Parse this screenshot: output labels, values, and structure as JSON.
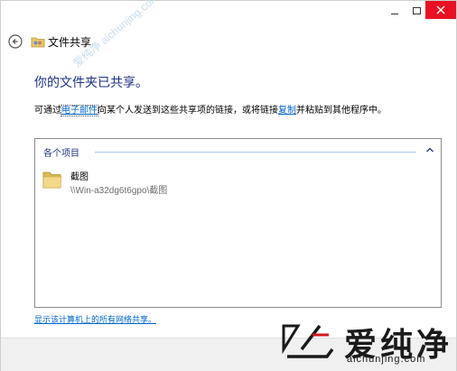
{
  "window": {
    "title": "文件共享"
  },
  "caption_buttons": {
    "minimize_icon": "minimize-icon",
    "maximize_icon": "maximize-icon",
    "close_icon": "close-icon"
  },
  "main": {
    "heading": "你的文件夹已共享。",
    "desc_prefix": "可通过",
    "desc_email_link": "电子邮件",
    "desc_middle": "向某个人发送到这些共享项的链接，或将链接",
    "desc_copy_link": "复制",
    "desc_suffix": "并粘贴到其他程序中。"
  },
  "panel": {
    "group_header": "各个项目",
    "items": [
      {
        "name": "截图",
        "path": "\\\\Win-a32dg6t6gpo\\截图",
        "icon": "folder-icon"
      }
    ]
  },
  "bottom_link": "显示该计算机上的所有网络共享。",
  "watermark": {
    "brand": "爱纯净",
    "url": "aichunjing.com",
    "diagonal": "爱纯净 aichunjing.com"
  },
  "colors": {
    "heading": "#1e3287",
    "link": "#0066cc",
    "close_button": "#e81123",
    "footer": "#f0f0f0"
  }
}
